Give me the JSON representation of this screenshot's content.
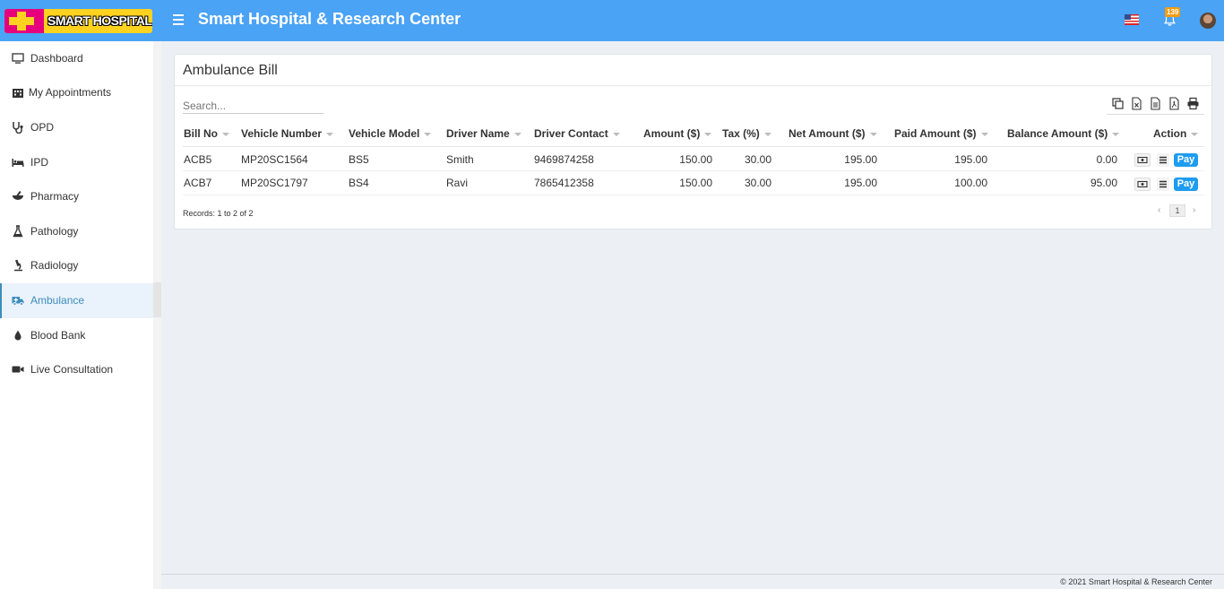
{
  "brand": {
    "logo_text": "SMART HOSPITAL",
    "app_title": "Smart Hospital & Research Center",
    "accent": "#4aa3f5"
  },
  "header": {
    "notification_count": "139",
    "icons": [
      "menu-icon",
      "us-flag-icon",
      "bell-icon",
      "avatar"
    ]
  },
  "sidebar": {
    "items": [
      {
        "label": "Dashboard",
        "icon": "monitor-icon"
      },
      {
        "label": "My Appointments",
        "icon": "hospital-icon"
      },
      {
        "label": "OPD",
        "icon": "stethoscope-icon"
      },
      {
        "label": "IPD",
        "icon": "bed-icon"
      },
      {
        "label": "Pharmacy",
        "icon": "mortar-pestle-icon"
      },
      {
        "label": "Pathology",
        "icon": "flask-icon"
      },
      {
        "label": "Radiology",
        "icon": "microscope-icon"
      },
      {
        "label": "Ambulance",
        "icon": "ambulance-icon",
        "active": true
      },
      {
        "label": "Blood Bank",
        "icon": "blood-drop-icon"
      },
      {
        "label": "Live Consultation",
        "icon": "video-icon"
      }
    ]
  },
  "main": {
    "title": "Ambulance Bill",
    "search_placeholder": "Search...",
    "export_icons": [
      "copy-icon",
      "excel-icon",
      "csv-icon",
      "pdf-icon",
      "print-icon"
    ],
    "columns": [
      "Bill No",
      "Vehicle Number",
      "Vehicle Model",
      "Driver Name",
      "Driver Contact",
      "Amount ($)",
      "Tax (%)",
      "Net Amount ($)",
      "Paid Amount ($)",
      "Balance Amount ($)",
      "Action"
    ],
    "rows": [
      {
        "bill_no": "ACB5",
        "vehicle_number": "MP20SC1564",
        "vehicle_model": "BS5",
        "driver_name": "Smith",
        "driver_contact": "9469874258",
        "amount": "150.00",
        "tax": "30.00",
        "net_amount": "195.00",
        "paid_amount": "195.00",
        "balance_amount": "0.00",
        "pay_label": "Pay"
      },
      {
        "bill_no": "ACB7",
        "vehicle_number": "MP20SC1797",
        "vehicle_model": "BS4",
        "driver_name": "Ravi",
        "driver_contact": "7865412358",
        "amount": "150.00",
        "tax": "30.00",
        "net_amount": "195.00",
        "paid_amount": "100.00",
        "balance_amount": "95.00",
        "pay_label": "Pay"
      }
    ],
    "records_text": "Records: 1 to 2 of 2",
    "pagination": {
      "prev": "‹",
      "current": "1",
      "next": "›"
    }
  },
  "footer": {
    "text": "© 2021 Smart Hospital & Research Center"
  }
}
